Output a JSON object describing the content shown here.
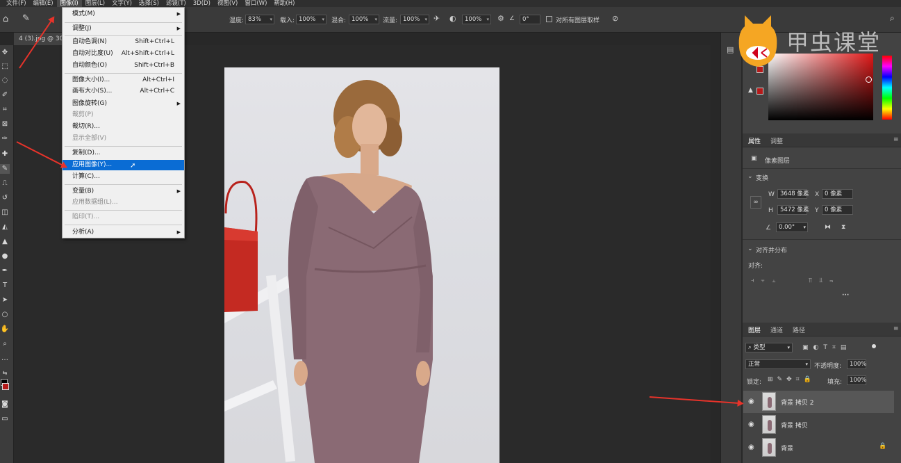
{
  "menubar": {
    "items": [
      "文件(F)",
      "编辑(E)",
      "图像(I)",
      "图层(L)",
      "文字(Y)",
      "选择(S)",
      "滤镜(T)",
      "3D(D)",
      "视图(V)",
      "窗口(W)",
      "帮助(H)"
    ]
  },
  "options": {
    "opacity_label": "湿度:",
    "opacity_value": "83%",
    "load_label": "载入:",
    "load_value": "100%",
    "mix_label": "混合:",
    "mix_value": "100%",
    "flow_label": "流量:",
    "flow_value": "100%",
    "pressure_value": "100%",
    "angle_value": "0°",
    "sample_all_label": "对所有图层取样"
  },
  "document_tab": "4 (3).jpg @ 30",
  "image_menu": {
    "items": [
      {
        "label": "模式(M)",
        "shortcut": "",
        "submenu": true,
        "disabled": false
      },
      {
        "label": "调整(J)",
        "shortcut": "",
        "submenu": true,
        "disabled": false
      },
      {
        "label": "自动色调(N)",
        "shortcut": "Shift+Ctrl+L",
        "submenu": false,
        "disabled": false
      },
      {
        "label": "自动对比度(U)",
        "shortcut": "Alt+Shift+Ctrl+L",
        "submenu": false,
        "disabled": false
      },
      {
        "label": "自动颜色(O)",
        "shortcut": "Shift+Ctrl+B",
        "submenu": false,
        "disabled": false
      },
      {
        "label": "图像大小(I)...",
        "shortcut": "Alt+Ctrl+I",
        "submenu": false,
        "disabled": false
      },
      {
        "label": "画布大小(S)...",
        "shortcut": "Alt+Ctrl+C",
        "submenu": false,
        "disabled": false
      },
      {
        "label": "图像旋转(G)",
        "shortcut": "",
        "submenu": true,
        "disabled": false
      },
      {
        "label": "裁剪(P)",
        "shortcut": "",
        "submenu": false,
        "disabled": true
      },
      {
        "label": "裁切(R)...",
        "shortcut": "",
        "submenu": false,
        "disabled": false
      },
      {
        "label": "显示全部(V)",
        "shortcut": "",
        "submenu": false,
        "disabled": true
      },
      {
        "label": "复制(D)...",
        "shortcut": "",
        "submenu": false,
        "disabled": false
      },
      {
        "label": "应用图像(Y)...",
        "shortcut": "",
        "submenu": false,
        "disabled": false,
        "highlighted": true
      },
      {
        "label": "计算(C)...",
        "shortcut": "",
        "submenu": false,
        "disabled": false
      },
      {
        "label": "变量(B)",
        "shortcut": "",
        "submenu": true,
        "disabled": false
      },
      {
        "label": "应用数据组(L)...",
        "shortcut": "",
        "submenu": false,
        "disabled": true
      },
      {
        "label": "陷印(T)...",
        "shortcut": "",
        "submenu": false,
        "disabled": true
      },
      {
        "label": "分析(A)",
        "shortcut": "",
        "submenu": true,
        "disabled": false
      }
    ]
  },
  "watermark": "甲虫课堂",
  "properties": {
    "tabs": [
      "属性",
      "调整"
    ],
    "layer_type": "像素图层",
    "transform_title": "变换",
    "w_label": "W",
    "w_value": "3648 像素",
    "x_label": "X",
    "x_value": "0 像素",
    "h_label": "H",
    "h_value": "5472 像素",
    "y_label": "Y",
    "y_value": "0 像素",
    "angle_value": "0.00°",
    "align_title": "对齐并分布",
    "align_label": "对齐:"
  },
  "layers": {
    "tabs": [
      "图层",
      "通道",
      "路径"
    ],
    "filter_label": "类型",
    "blend_mode": "正常",
    "opacity_label": "不透明度:",
    "opacity_value": "100%",
    "lock_label": "锁定:",
    "fill_label": "填充:",
    "fill_value": "100%",
    "items": [
      {
        "name": "背景 拷贝 2"
      },
      {
        "name": "背景 拷贝"
      },
      {
        "name": "背景"
      }
    ]
  },
  "colors": {
    "foreground": "#b51a1a",
    "highlight": "#0a6cd4",
    "arrow": "#e8332a",
    "dress": "#8a6a74"
  }
}
